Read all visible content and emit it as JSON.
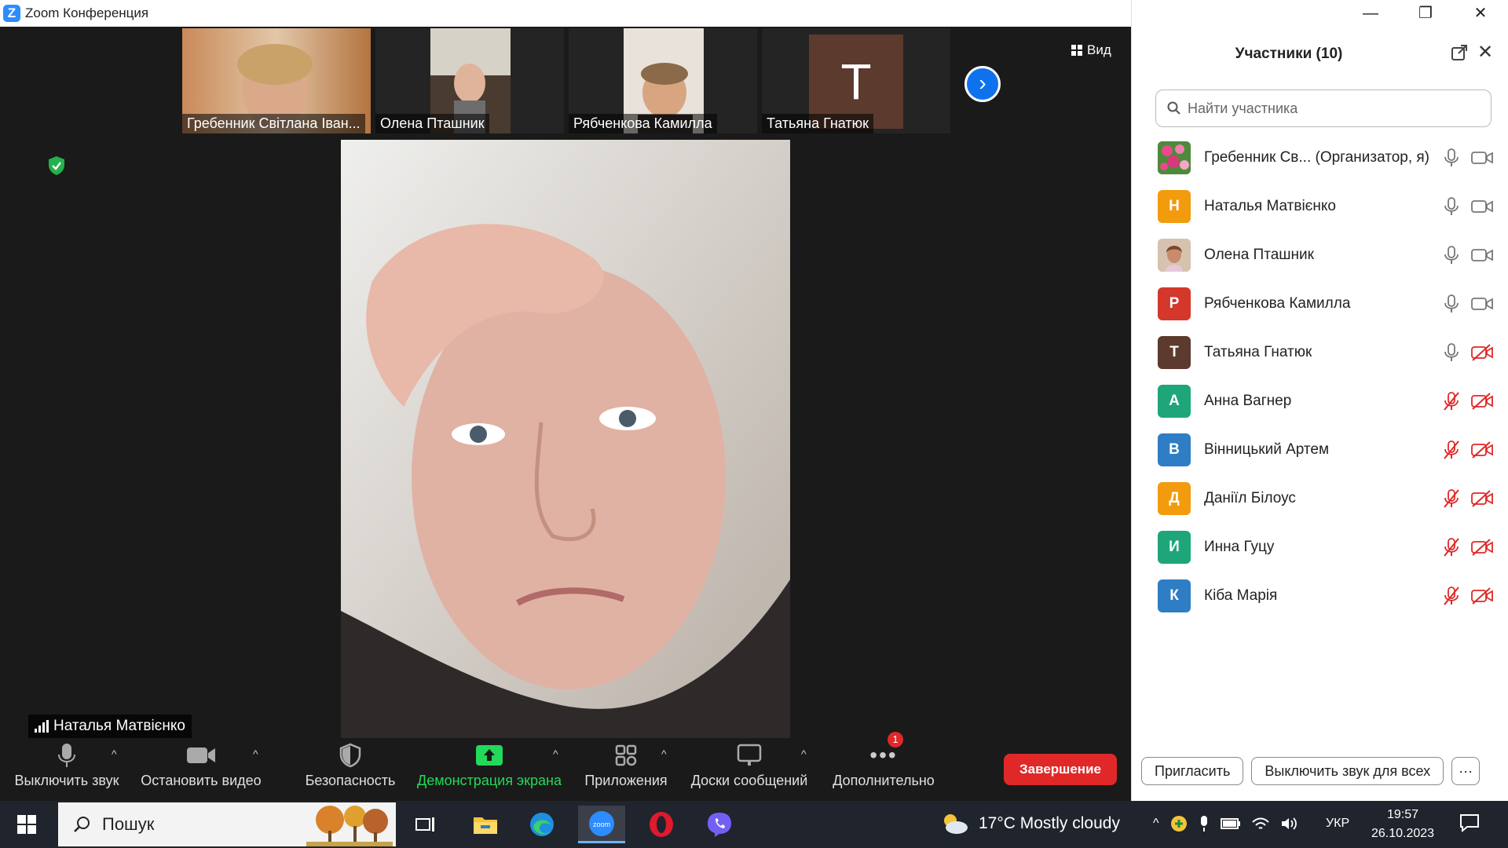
{
  "window": {
    "title": "Zoom Конференция",
    "logo_letter": "Z"
  },
  "gallery": {
    "thumbnails": [
      {
        "name": "Гребенник Світлана Іван..."
      },
      {
        "name": "Олена Пташник"
      },
      {
        "name": "Рябченкова Камилла"
      },
      {
        "name": "Татьяна Гнатюк",
        "avatar_letter": "T"
      }
    ],
    "view_label": "Вид",
    "next_arrow": "›"
  },
  "speaker": {
    "name": "Наталья Матвієнко"
  },
  "toolbar": {
    "mute": "Выключить звук",
    "video": "Остановить видео",
    "security": "Безопасность",
    "share": "Демонстрация экрана",
    "apps": "Приложения",
    "whiteboards": "Доски сообщений",
    "more": "Дополнительно",
    "more_badge": "1",
    "end": "Завершение",
    "caret": "^"
  },
  "participants": {
    "title": "Участники (10)",
    "search_placeholder": "Найти участника",
    "list": [
      {
        "name": "Гребенник Св... (Организатор, я)",
        "avatar": "",
        "color": "#c2185b",
        "mic": "on",
        "cam": "on"
      },
      {
        "name": "Наталья Матвієнко",
        "avatar": "Н",
        "color": "#f29b0c",
        "mic": "on",
        "cam": "on"
      },
      {
        "name": "Олена Пташник",
        "avatar": "",
        "color": "#b0836a",
        "mic": "on",
        "cam": "on"
      },
      {
        "name": "Рябченкова Камилла",
        "avatar": "Р",
        "color": "#d3382b",
        "mic": "on",
        "cam": "on"
      },
      {
        "name": "Татьяна Гнатюк",
        "avatar": "Т",
        "color": "#5c3a2e",
        "mic": "on",
        "cam": "off"
      },
      {
        "name": "Анна Вагнер",
        "avatar": "А",
        "color": "#1ea67a",
        "mic": "off",
        "cam": "off"
      },
      {
        "name": "Вінницький Артем",
        "avatar": "В",
        "color": "#2e7dc5",
        "mic": "off",
        "cam": "off"
      },
      {
        "name": "Даніїл Білоус",
        "avatar": "Д",
        "color": "#f29b0c",
        "mic": "off",
        "cam": "off"
      },
      {
        "name": "Инна Гуцу",
        "avatar": "И",
        "color": "#1ea67a",
        "mic": "off",
        "cam": "off"
      },
      {
        "name": "Кіба Марія",
        "avatar": "К",
        "color": "#2e7dc5",
        "mic": "off",
        "cam": "off"
      }
    ],
    "invite": "Пригласить",
    "mute_all": "Выключить звук для всех",
    "more": "···"
  },
  "window_controls": {
    "minimize": "—",
    "restore": "❐",
    "close": "✕"
  },
  "taskbar": {
    "search_label": "Пошук",
    "weather": "17°C  Mostly cloudy",
    "language": "УКР",
    "time": "19:57",
    "date": "26.10.2023",
    "tray_caret": "^"
  },
  "colors": {
    "accent": "#0e72ed",
    "end": "#e02828",
    "share_green": "#23d959",
    "muted_red": "#e02828"
  }
}
